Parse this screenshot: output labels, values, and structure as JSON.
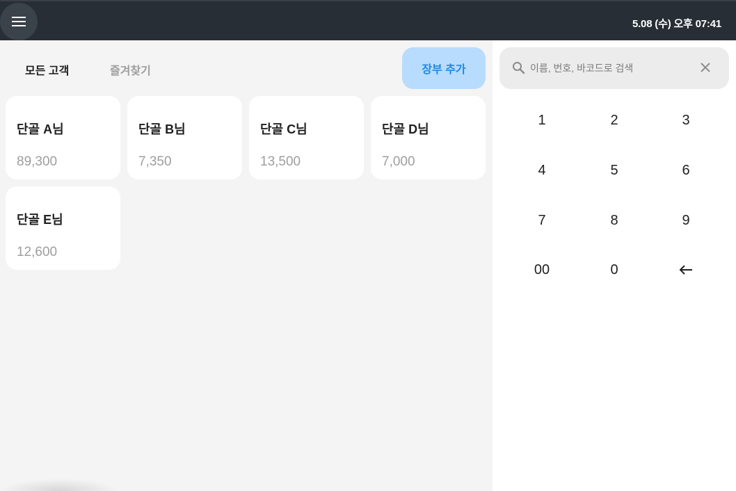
{
  "topbar": {
    "menu_icon": "menu-icon",
    "datetime": "5.08 (수) 오후 07:41"
  },
  "tabs": {
    "all_customers": "모든 고객",
    "favorites": "즐겨찾기"
  },
  "add_ledger_label": "장부 추가",
  "customers": [
    {
      "name": "단골 A님",
      "amount": "89,300"
    },
    {
      "name": "단골 B님",
      "amount": "7,350"
    },
    {
      "name": "단골 C님",
      "amount": "13,500"
    },
    {
      "name": "단골 D님",
      "amount": "7,000"
    },
    {
      "name": "단골 E님",
      "amount": "12,600"
    }
  ],
  "search": {
    "placeholder": "이름, 번호, 바코드로 검색",
    "value": "",
    "search_icon": "search-icon",
    "clear_icon": "close-icon"
  },
  "keypad": {
    "keys": [
      "1",
      "2",
      "3",
      "4",
      "5",
      "6",
      "7",
      "8",
      "9",
      "00",
      "0"
    ],
    "backspace_icon": "backspace-arrow-icon"
  },
  "colors": {
    "topbar": "#272e35",
    "accent": "#1e88e5",
    "accent_bg": "#b8dcfd",
    "background": "#f4f4f4"
  }
}
